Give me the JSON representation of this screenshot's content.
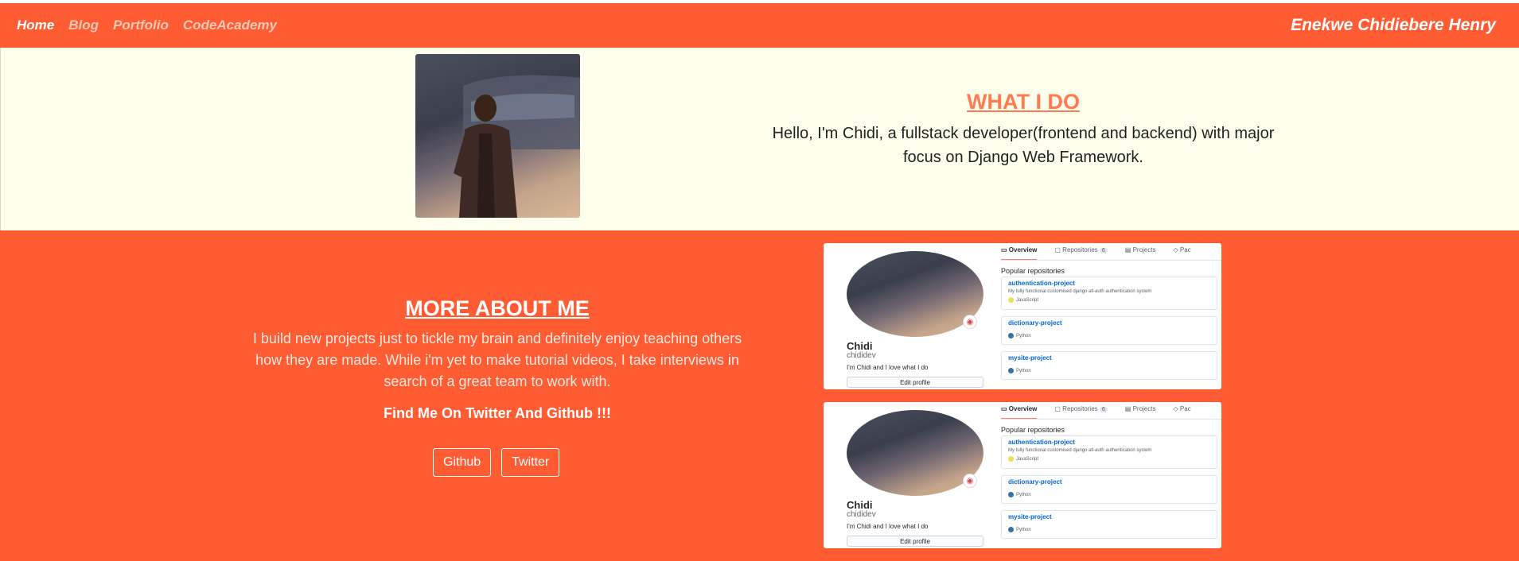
{
  "nav": {
    "links": [
      {
        "label": "Home"
      },
      {
        "label": "Blog"
      },
      {
        "label": "Portfolio"
      },
      {
        "label": "CodeAcademy"
      }
    ],
    "brand": "Enekwe Chidiebere Henry"
  },
  "intro": {
    "title": "WHAT I DO",
    "text": "Hello, I'm Chidi, a fullstack developer(frontend and backend) with major focus on Django Web Framework."
  },
  "about": {
    "title": "MORE ABOUT ME",
    "text": "I build new projects just to tickle my brain and definitely enjoy teaching others how they are made. While i'm yet to make tutorial videos, I take interviews in search of a great team to work with.",
    "cta": "Find Me On Twitter And Github !!!",
    "buttons": [
      {
        "label": "Github"
      },
      {
        "label": "Twitter"
      }
    ]
  },
  "github_card": {
    "name": "Chidi",
    "username": "chididev",
    "bio": "I'm Chidi and I love what I do",
    "edit_label": "Edit profile",
    "tabs": [
      {
        "label": "Overview"
      },
      {
        "label": "Repositories",
        "count": "6"
      },
      {
        "label": "Projects"
      },
      {
        "label": "Pac"
      }
    ],
    "popular_label": "Popular repositories",
    "repos": [
      {
        "name": "authentication-project",
        "desc": "My fully functional customised django all-auth authentication system",
        "lang": "JavaScript",
        "lang_color": "#f1e05a"
      },
      {
        "name": "dictionary-project",
        "desc": "",
        "lang": "Python",
        "lang_color": "#3572A5"
      },
      {
        "name": "mysite-project",
        "desc": "",
        "lang": "Python",
        "lang_color": "#3572A5"
      }
    ]
  },
  "colors": {
    "accent": "#ff5c33",
    "cream": "#fefeed",
    "title_orange": "#ff7a52"
  }
}
